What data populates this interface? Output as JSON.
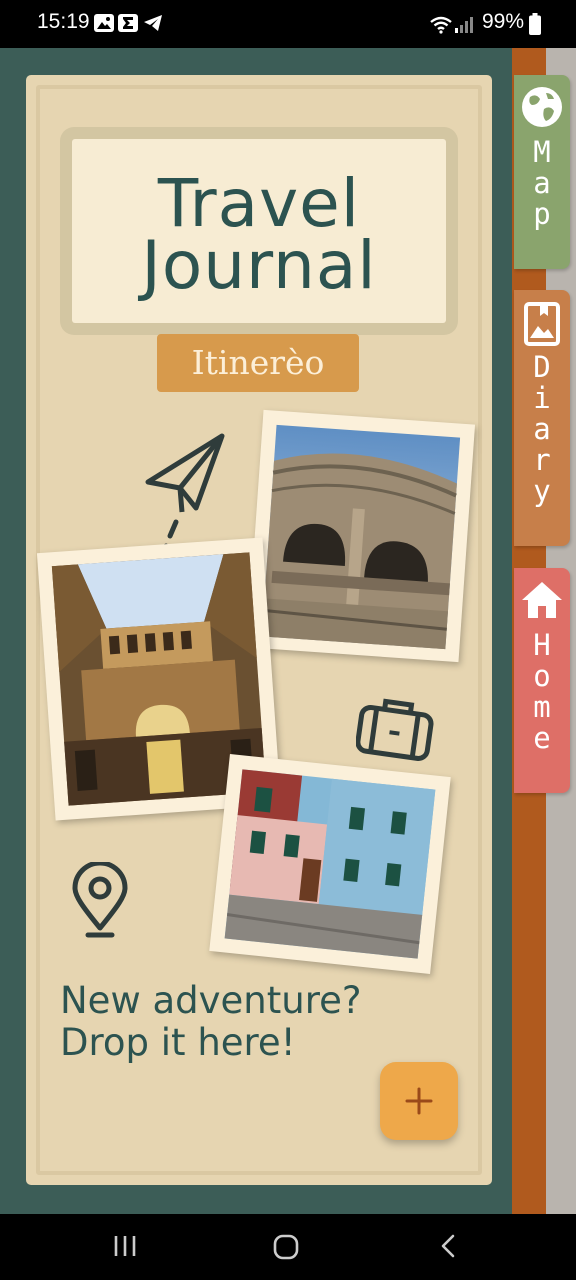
{
  "status_bar": {
    "time": "15:19",
    "battery": "99%",
    "icons": [
      "image-icon",
      "sigma-icon",
      "telegram-icon",
      "wifi-icon",
      "signal-icon",
      "battery-icon"
    ]
  },
  "header": {
    "title_line1": "Travel",
    "title_line2": "Journal",
    "brand": "Itinerèo"
  },
  "main": {
    "prompt_line1": "New adventure?",
    "prompt_line2": "Drop it here!",
    "add_button_icon": "plus-icon",
    "doodles": [
      "paper-plane-icon",
      "suitcase-icon",
      "location-pin-icon"
    ],
    "photos": [
      "colosseum-photo",
      "uffizi-courtyard-photo",
      "colorful-houses-photo"
    ]
  },
  "tabs": [
    {
      "label": "Map",
      "icon": "globe-icon",
      "color": "#8aa46d"
    },
    {
      "label": "Diary",
      "icon": "photo-book-icon",
      "color": "#c77f4a"
    },
    {
      "label": "Home",
      "icon": "home-icon",
      "color": "#de6f67"
    }
  ],
  "nav_bar": {
    "buttons": [
      "recent-apps-button",
      "home-button",
      "back-button"
    ]
  },
  "colors": {
    "background": "#3c5d57",
    "page": "#e6d5b1",
    "title_text": "#2c5350",
    "brand_bg": "#d79a4c",
    "fab": "#eea84a",
    "spine": "#b05a1e"
  }
}
